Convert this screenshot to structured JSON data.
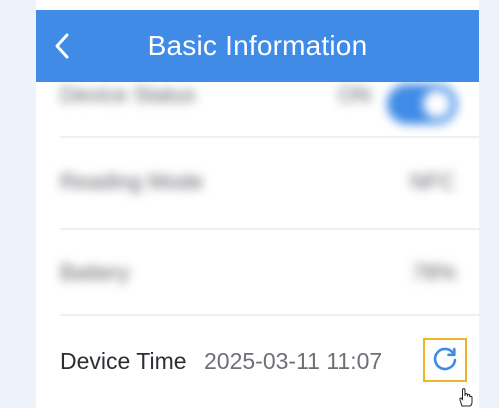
{
  "header": {
    "title": "Basic Information",
    "back_icon": "chevron-left-icon",
    "color": "#3f8be6"
  },
  "rows": {
    "device_status": {
      "label": "Device Status",
      "value": "ON",
      "toggle_color": "#3f8be6"
    },
    "reading_mode": {
      "label": "Reading Mode",
      "value": "NFC"
    },
    "battery": {
      "label": "Battery",
      "value": "78%"
    },
    "device_time": {
      "label": "Device Time",
      "value": "2025-03-11 11:07",
      "refresh_icon": "refresh-icon",
      "highlight_color": "#f0b428"
    }
  }
}
